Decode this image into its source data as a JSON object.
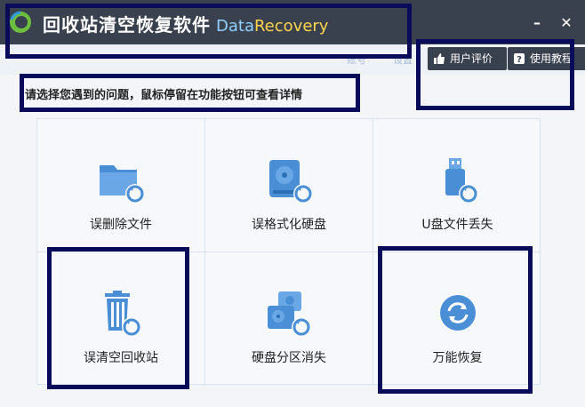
{
  "window": {
    "title_cn": "回收站清空恢复软件",
    "title_en_data": "Data",
    "title_en_recovery": "Recovery",
    "minimize_label": "–",
    "close_label": "✕"
  },
  "header": {
    "faded_link_1": "账号",
    "faded_link_2": "设置",
    "review_button": "用户评价",
    "tutorial_button": "使用教程"
  },
  "instruction": "请选择您遇到的问题，鼠标停留在功能按钮可查看详情",
  "options": [
    {
      "label": "误删除文件",
      "icon": "folder-restore-icon"
    },
    {
      "label": "误格式化硬盘",
      "icon": "harddisk-restore-icon"
    },
    {
      "label": "U盘文件丢失",
      "icon": "usb-restore-icon"
    },
    {
      "label": "误清空回收站",
      "icon": "recycle-bin-restore-icon"
    },
    {
      "label": "硬盘分区消失",
      "icon": "partition-restore-icon"
    },
    {
      "label": "万能恢复",
      "icon": "universal-restore-icon"
    }
  ],
  "colors": {
    "titlebar": "#3a414e",
    "icon_blue": "#4a8fd6",
    "highlight_box": "#0a0a5a"
  }
}
